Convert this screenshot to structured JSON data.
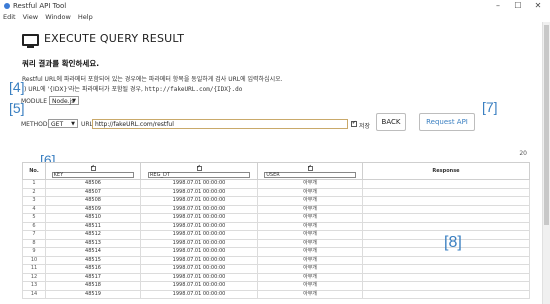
{
  "window": {
    "title": "Restful API Tool",
    "minimize": "–",
    "maximize": "☐",
    "close": "✕"
  },
  "menu": [
    "Edit",
    "View",
    "Window",
    "Help"
  ],
  "page": {
    "title": "EXECUTE QUERY RESULT",
    "subtitle": "쿼리 결과를 확인하세요.",
    "desc_line1": "Restful URL에 파라메터 포함되어 있는 경우에는 파라메터 항목을 동일하게 검사 URL에 입력하십시오.",
    "desc_line2_prefix": ") URL에 '{IDX}'라는 파라메터가 포함될 경우,",
    "desc_line2_example": "http://fakeURL.com/{IDX}.do"
  },
  "annotations": [
    "[4]",
    "[5]",
    "[6]",
    "[7]",
    "[8]"
  ],
  "form": {
    "module_label": "MODULE",
    "module_value": "Node.js",
    "method_label": "METHOD",
    "method_value": "GET",
    "url_label": "URL",
    "url_value": "http://fakeURL.com/restful",
    "save_label": "저장",
    "back_button": "BACK",
    "request_button": "Request API"
  },
  "result_count": "20",
  "table": {
    "columns": [
      "No.",
      "KEY",
      "REG_DT",
      "USER",
      "Response"
    ],
    "rows": [
      [
        "1",
        "48506",
        "1998.07.01 00:00:00",
        "아무개"
      ],
      [
        "2",
        "48507",
        "1998.07.01 00:00:00",
        "아무개"
      ],
      [
        "3",
        "48508",
        "1998.07.01 00:00:00",
        "아무개"
      ],
      [
        "4",
        "48509",
        "1998.07.01 00:00:00",
        "아무개"
      ],
      [
        "5",
        "48510",
        "1998.07.01 00:00:00",
        "아무개"
      ],
      [
        "6",
        "48511",
        "1998.07.01 00:00:00",
        "아무개"
      ],
      [
        "7",
        "48512",
        "1998.07.01 00:00:00",
        "아무개"
      ],
      [
        "8",
        "48513",
        "1998.07.01 00:00:00",
        "아무개"
      ],
      [
        "9",
        "48514",
        "1998.07.01 00:00:00",
        "아무개"
      ],
      [
        "10",
        "48515",
        "1998.07.01 00:00:00",
        "아무개"
      ],
      [
        "11",
        "48516",
        "1998.07.01 00:00:00",
        "아무개"
      ],
      [
        "12",
        "48517",
        "1998.07.01 00:00:00",
        "아무개"
      ],
      [
        "13",
        "48518",
        "1998.07.01 00:00:00",
        "아무개"
      ],
      [
        "14",
        "48519",
        "1998.07.01 00:00:00",
        "아무개"
      ]
    ]
  },
  "colors": {
    "annotation": "#3a7fc1",
    "url_border": "#c9a96a"
  }
}
